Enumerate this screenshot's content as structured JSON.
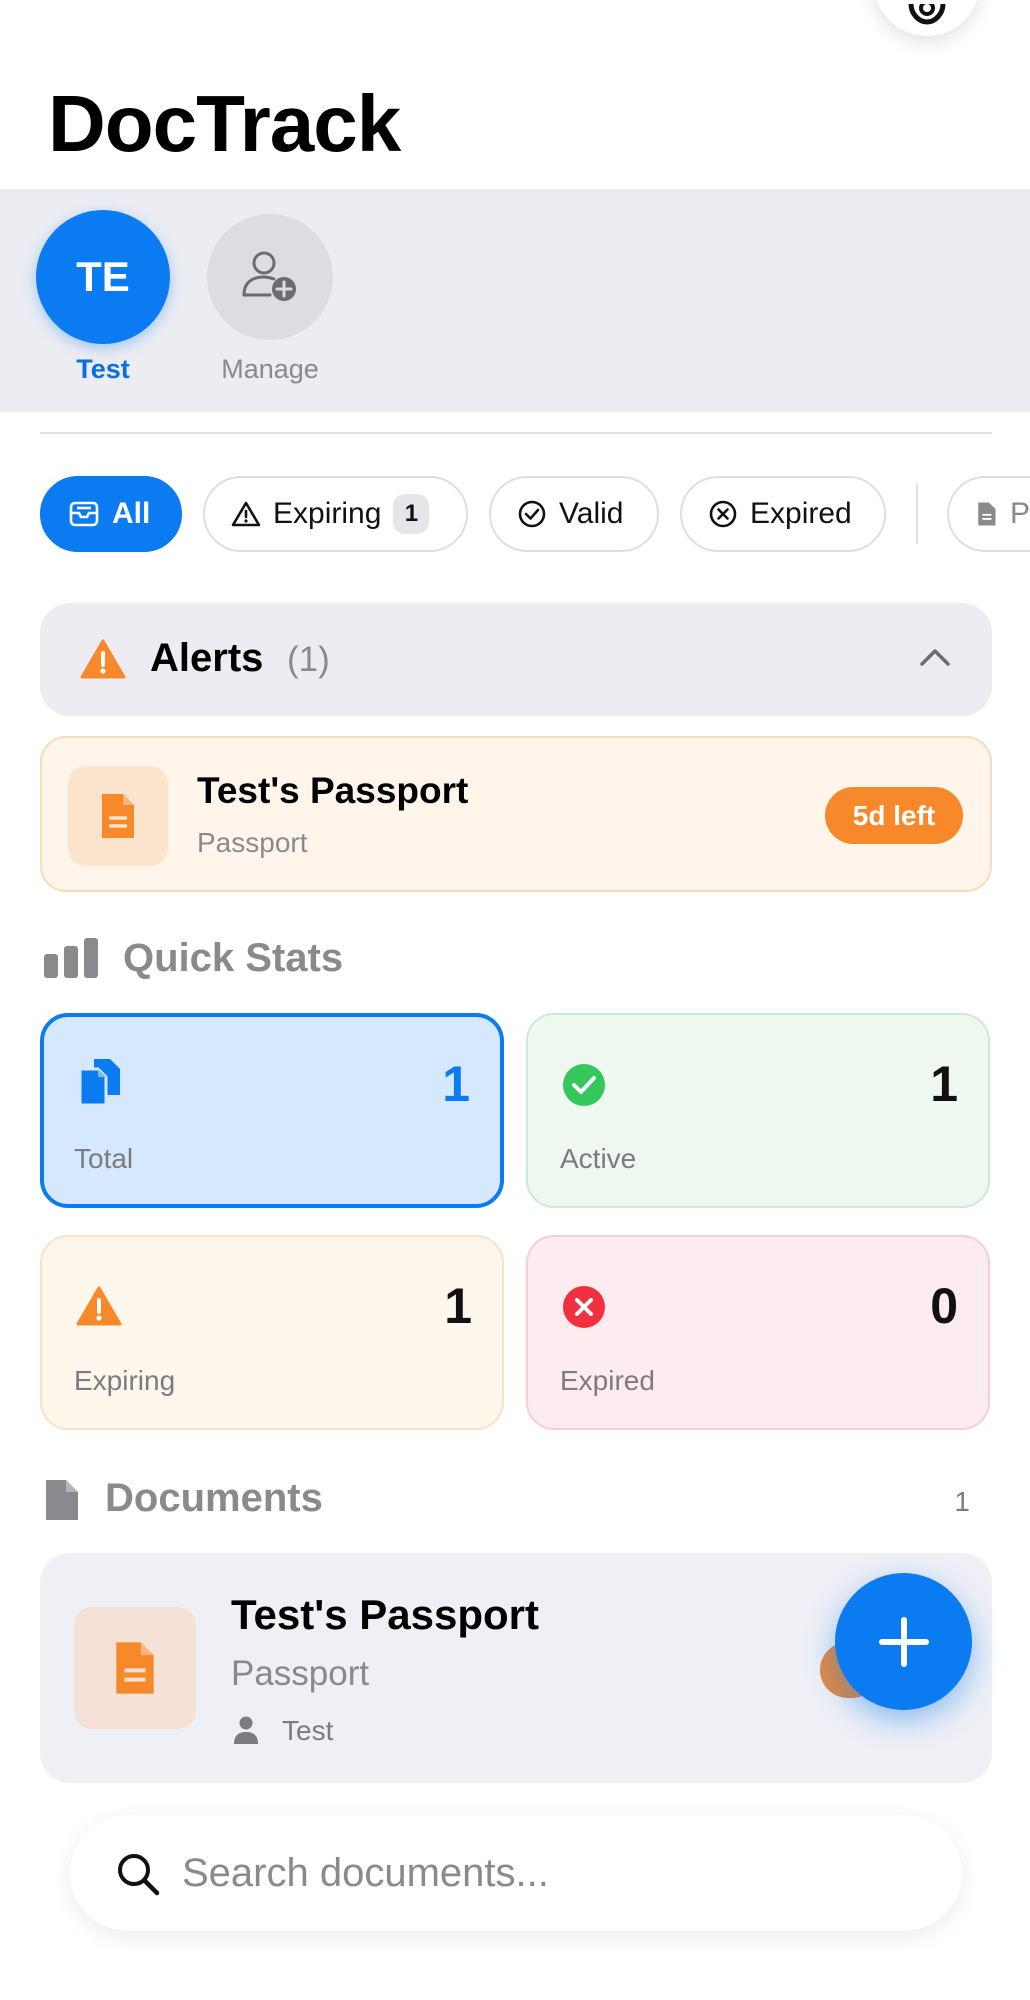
{
  "app": {
    "title": "DocTrack"
  },
  "profiles": {
    "active": {
      "initials": "TE",
      "label": "Test"
    },
    "manage": {
      "label": "Manage"
    }
  },
  "filters": {
    "all": "All",
    "expiring": "Expiring",
    "expiring_count": "1",
    "valid": "Valid",
    "expired": "Expired",
    "partial": "P"
  },
  "alerts": {
    "title": "Alerts",
    "count": "(1)",
    "items": [
      {
        "name": "Test's Passport",
        "type": "Passport",
        "badge": "5d left"
      }
    ]
  },
  "stats": {
    "title": "Quick Stats",
    "total": {
      "value": "1",
      "label": "Total"
    },
    "active": {
      "value": "1",
      "label": "Active"
    },
    "expiring": {
      "value": "1",
      "label": "Expiring"
    },
    "expired": {
      "value": "0",
      "label": "Expired"
    }
  },
  "documents": {
    "title": "Documents",
    "count": "1",
    "items": [
      {
        "name": "Test's Passport",
        "type": "Passport",
        "owner": "Test"
      }
    ]
  },
  "search": {
    "placeholder": "Search documents..."
  },
  "colors": {
    "accent": "#0a7bf0",
    "warning": "#f7892a",
    "success": "#34c759",
    "danger": "#f0303e"
  }
}
